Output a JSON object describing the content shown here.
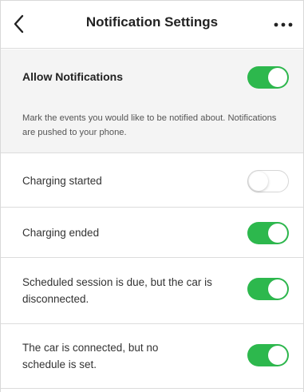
{
  "header": {
    "title": "Notification Settings",
    "back_icon": "chevron-left-icon",
    "more_icon": "more-horizontal-icon"
  },
  "allow": {
    "title": "Allow Notifications",
    "enabled": true,
    "description": "Mark the events you would like to be notified about. Notifications are pushed to your phone."
  },
  "rows": [
    {
      "label": "Charging started",
      "enabled": false
    },
    {
      "label": "Charging ended",
      "enabled": true
    },
    {
      "label": "Scheduled session is due, but the car is disconnected.",
      "enabled": true
    },
    {
      "label": "The car is connected, but no schedule is set.",
      "enabled": true
    }
  ],
  "colors": {
    "toggle_on": "#2db84d",
    "toggle_off": "#ffffff",
    "section_bg": "#f4f4f4"
  }
}
